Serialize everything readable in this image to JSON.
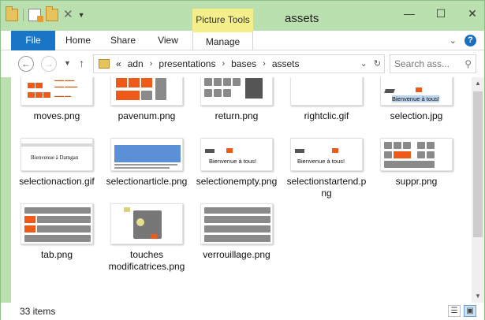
{
  "window": {
    "title": "assets"
  },
  "contextual_tab": {
    "label": "Picture Tools"
  },
  "ribbon": {
    "tabs": [
      "File",
      "Home",
      "Share",
      "View",
      "Manage"
    ]
  },
  "address": {
    "overflow": "«",
    "crumbs": [
      "adn",
      "presentations",
      "bases",
      "assets"
    ]
  },
  "search": {
    "placeholder": "Search ass..."
  },
  "files": [
    {
      "name": "moves.png"
    },
    {
      "name": "pavenum.png"
    },
    {
      "name": "return.png"
    },
    {
      "name": "rightclic.gif"
    },
    {
      "name": "selection.jpg"
    },
    {
      "name": "selectionaction.gif"
    },
    {
      "name": "selectionarticle.png"
    },
    {
      "name": "selectionempty.png"
    },
    {
      "name": "selectionstartend.png"
    },
    {
      "name": "suppr.png"
    },
    {
      "name": "tab.png"
    },
    {
      "name": "touches modificatrices.png"
    },
    {
      "name": "verrouillage.png"
    }
  ],
  "thumb_text": {
    "bienvenue": "Bienvenue à tous!",
    "damgan": "Bienvenue à Damgan"
  },
  "status": {
    "count": "33 items"
  },
  "colors": {
    "accent": "#1976c6",
    "key_orange": "#ee5a1a",
    "context": "#f4ef8a"
  }
}
